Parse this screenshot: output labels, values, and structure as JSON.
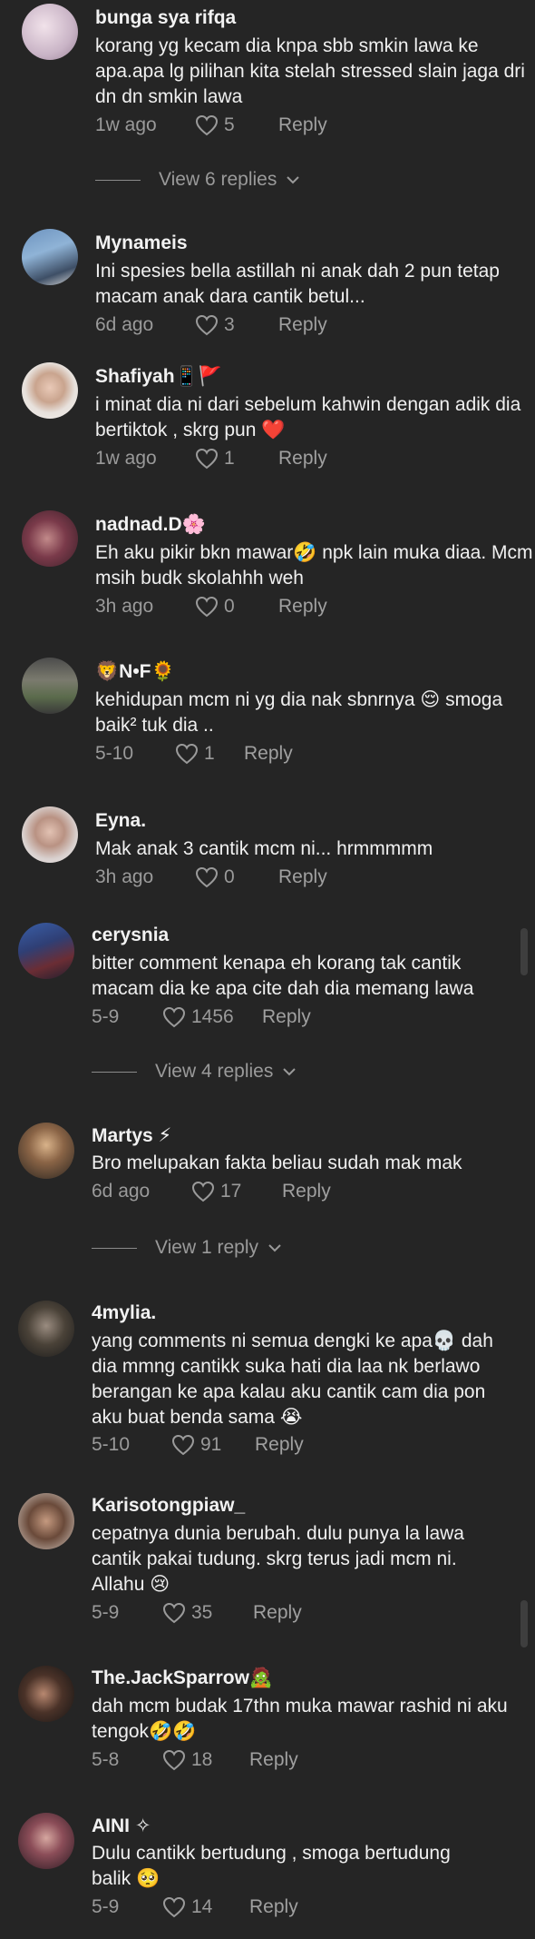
{
  "comments": [
    {
      "username": "bunga sya rifqa",
      "text": "korang yg kecam dia knpa sbb smkin lawa ke apa.apa lg pilihan kita stelah stressed slain jaga dri dn dn smkin lawa",
      "ago": "1w ago",
      "likes": "5",
      "reply": "Reply"
    },
    {
      "username": "Mynameis",
      "text": "Ini spesies bella astillah ni anak dah 2 pun tetap macam anak dara cantik betul...",
      "ago": "6d ago",
      "likes": "3",
      "reply": "Reply"
    },
    {
      "username": "Shafiyah📱🚩",
      "text": "i minat dia ni dari sebelum kahwin dengan adik dia bertiktok , skrg pun ❤️",
      "ago": "1w ago",
      "likes": "1",
      "reply": "Reply"
    },
    {
      "username": "nadnad.D🌸",
      "text": "Eh aku pikir bkn mawar🤣 npk lain muka diaa. Mcm msih budk skolahhh weh",
      "ago": "3h ago",
      "likes": "0",
      "reply": "Reply"
    },
    {
      "username": "🦁N•F🌻",
      "text": "kehidupan mcm ni yg dia nak sbnrnya 😌 smoga baik² tuk dia ..",
      "ago": "5-10",
      "likes": "1",
      "reply": "Reply"
    },
    {
      "username": "Eyna.",
      "text": "Mak anak 3 cantik mcm ni... hrmmmmm",
      "ago": "3h ago",
      "likes": "0",
      "reply": "Reply"
    },
    {
      "username": "cerysnia",
      "text": "bitter comment kenapa eh korang tak cantik macam dia ke apa cite dah dia memang lawa",
      "ago": "5-9",
      "likes": "1456",
      "reply": "Reply"
    },
    {
      "username": "Martys ⚡",
      "text": "Bro melupakan fakta beliau sudah mak mak",
      "ago": "6d ago",
      "likes": "17",
      "reply": "Reply"
    },
    {
      "username": "4mylia.",
      "text": "yang comments ni semua dengki ke apa💀 dah dia mmng cantikk suka hati dia laa nk berlawo berangan ke apa kalau aku cantik cam dia pon aku buat benda sama 😭",
      "ago": "5-10",
      "likes": "91",
      "reply": "Reply"
    },
    {
      "username": "Karisotongpiaw_",
      "text": "cepatnya dunia berubah. dulu punya la lawa cantik pakai tudung. skrg terus jadi mcm ni. Allahu 😢",
      "ago": "5-9",
      "likes": "35",
      "reply": "Reply"
    },
    {
      "username": "The.JackSparrow🧟",
      "text": "dah mcm budak 17thn muka mawar rashid ni aku tengok🤣🤣",
      "ago": "5-8",
      "likes": "18",
      "reply": "Reply"
    },
    {
      "username": "AINI ✧",
      "text": "Dulu cantikk bertudung , smoga bertudung balik 🥺",
      "ago": "5-9",
      "likes": "14",
      "reply": "Reply"
    }
  ],
  "view_replies": [
    {
      "label": "View 6 replies"
    },
    {
      "label": "View 4 replies"
    },
    {
      "label": "View 1 reply"
    }
  ],
  "colors": {
    "background": "#252525",
    "text": "#ffffff",
    "muted": "#9a9a9a"
  },
  "icons": {
    "like": "heart-outline-icon",
    "expand": "chevron-down-icon"
  }
}
